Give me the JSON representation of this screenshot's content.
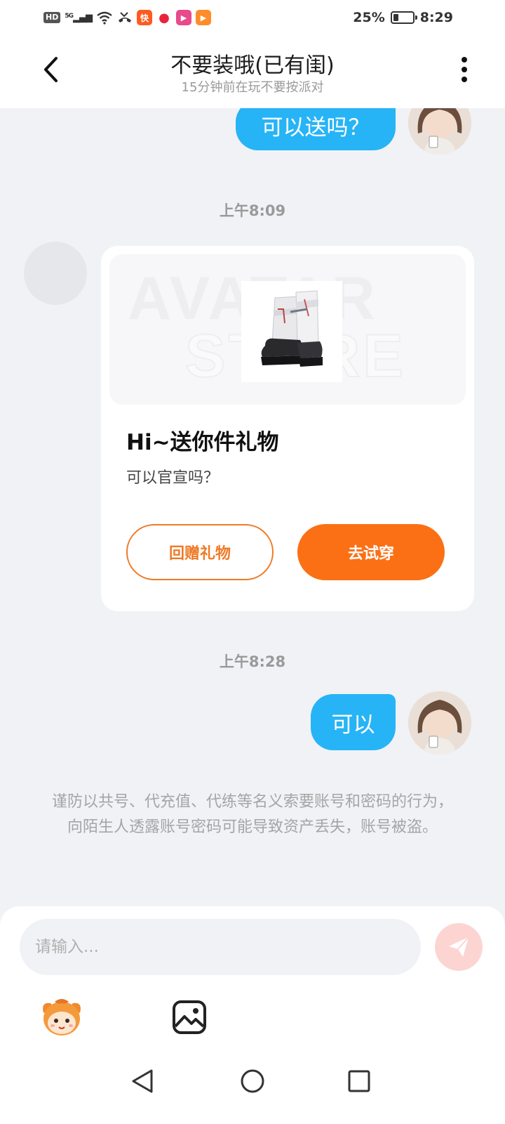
{
  "status_bar": {
    "hd": "HD",
    "network": "5G",
    "battery_text": "25%",
    "battery_level": 0.25,
    "time": "8:29",
    "app_icons": [
      {
        "name": "kuaishou-app-icon",
        "color": "#ff5a1f",
        "glyph": "快"
      },
      {
        "name": "red-app-icon",
        "color": "#e8243b",
        "glyph": "●"
      },
      {
        "name": "video-app-icon",
        "color": "#e84a8c",
        "glyph": "▶"
      },
      {
        "name": "orange-app-icon",
        "color": "#ff8c2a",
        "glyph": "▶"
      }
    ]
  },
  "header": {
    "title": "不要装哦(已有闺)",
    "subtitle": "15分钟前在玩不要按派对"
  },
  "messages": {
    "msg1_text": "可以送吗？",
    "time1": "上午8:09",
    "gift": {
      "watermark_line1": "AVATAR",
      "watermark_line2": "STORE",
      "title": "Hi~送你件礼物",
      "desc": "可以官宣吗？",
      "return_label": "回赠礼物",
      "try_label": "去试穿"
    },
    "time2": "上午8:28",
    "msg2_text": "可以"
  },
  "warning": "谨防以共号、代充值、代练等名义索要账号和密码的行为，向陌生人透露账号密码可能导致资产丢失，账号被盗。",
  "input": {
    "placeholder": "请输入..."
  },
  "colors": {
    "accent_blue": "#27b4f6",
    "accent_orange": "#fb7015",
    "send_disabled": "#fcd5d2"
  }
}
